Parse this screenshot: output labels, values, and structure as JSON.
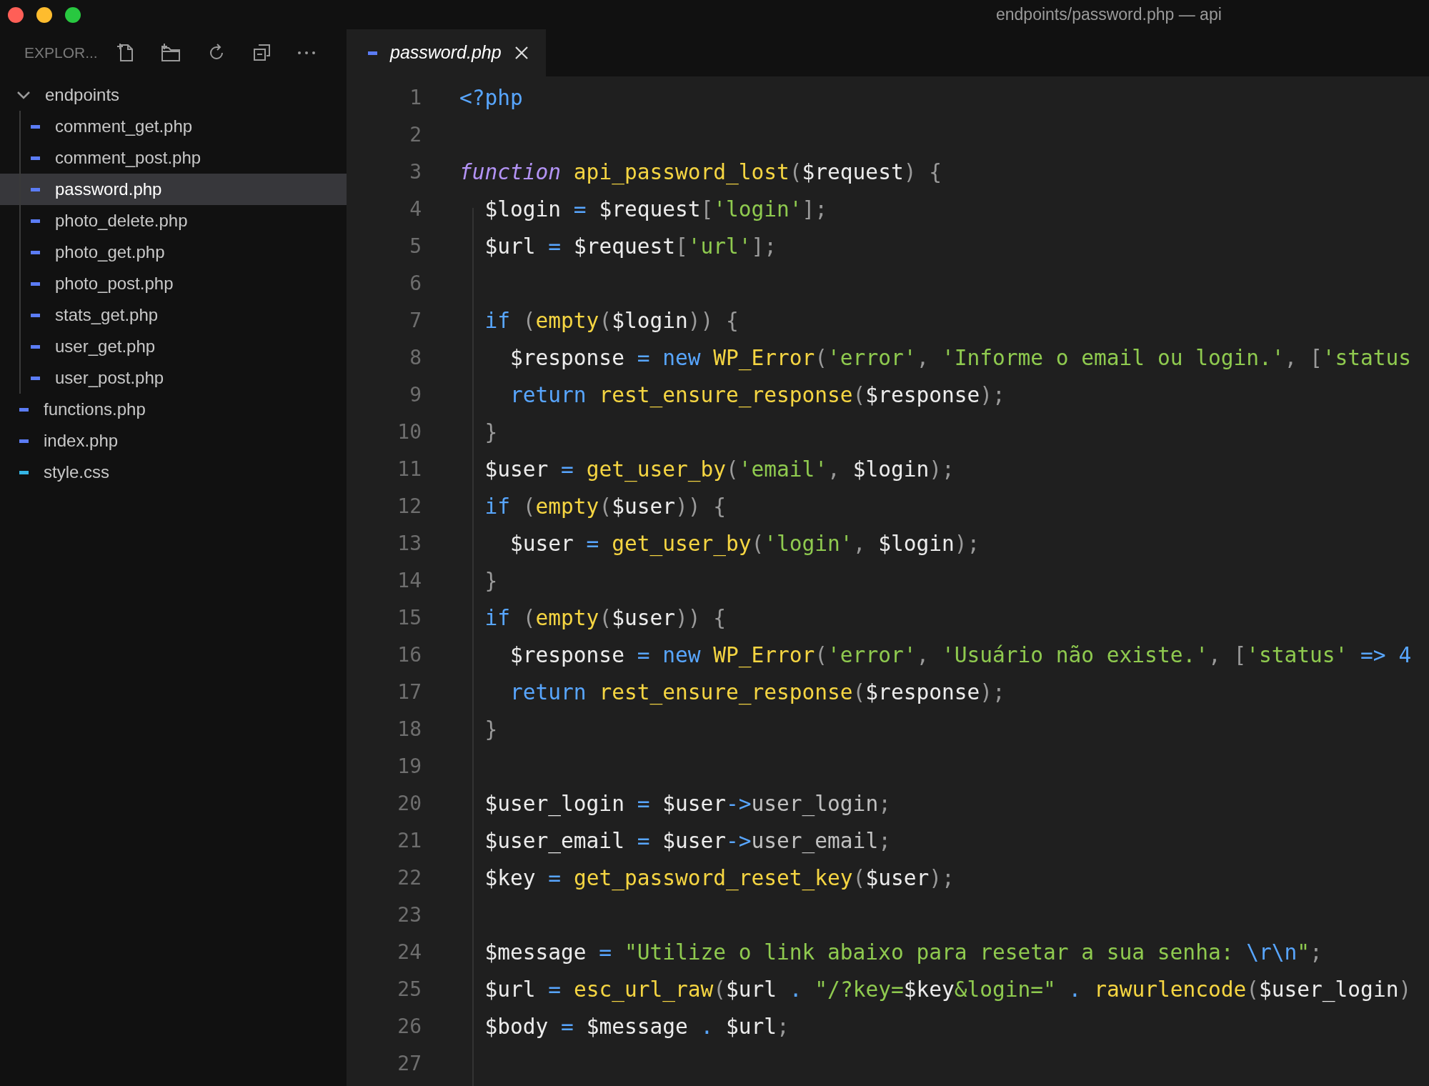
{
  "window": {
    "title": "endpoints/password.php — api"
  },
  "explorer": {
    "title": "EXPLOR...",
    "tree": [
      {
        "label": "endpoints",
        "kind": "folder",
        "expanded": true,
        "selected": false,
        "children": [
          {
            "label": "comment_get.php",
            "kind": "file",
            "selected": false,
            "color": "#5b7cf5"
          },
          {
            "label": "comment_post.php",
            "kind": "file",
            "selected": false,
            "color": "#5b7cf5"
          },
          {
            "label": "password.php",
            "kind": "file",
            "selected": true,
            "color": "#5b7cf5"
          },
          {
            "label": "photo_delete.php",
            "kind": "file",
            "selected": false,
            "color": "#5b7cf5"
          },
          {
            "label": "photo_get.php",
            "kind": "file",
            "selected": false,
            "color": "#5b7cf5"
          },
          {
            "label": "photo_post.php",
            "kind": "file",
            "selected": false,
            "color": "#5b7cf5"
          },
          {
            "label": "stats_get.php",
            "kind": "file",
            "selected": false,
            "color": "#5b7cf5"
          },
          {
            "label": "user_get.php",
            "kind": "file",
            "selected": false,
            "color": "#5b7cf5"
          },
          {
            "label": "user_post.php",
            "kind": "file",
            "selected": false,
            "color": "#5b7cf5"
          }
        ]
      },
      {
        "label": "functions.php",
        "kind": "file",
        "selected": false,
        "color": "#5b7cf5"
      },
      {
        "label": "index.php",
        "kind": "file",
        "selected": false,
        "color": "#5b7cf5"
      },
      {
        "label": "style.css",
        "kind": "file",
        "selected": false,
        "color": "#35b6e6"
      }
    ]
  },
  "tabs": [
    {
      "label": "password.php",
      "selected": true,
      "preview": true,
      "color": "#5b7cf5"
    }
  ],
  "editor": {
    "lines": [
      {
        "number": "1",
        "tokens": [
          {
            "text": "<?php",
            "kind": "k"
          }
        ]
      },
      {
        "number": "2"
      },
      {
        "number": "3",
        "tokens": [
          {
            "text": "function ",
            "kind": "s"
          },
          {
            "text": "api_password_lost",
            "kind": "f"
          },
          {
            "text": "(",
            "kind": "p"
          },
          {
            "text": "$request",
            "kind": "t"
          },
          {
            "text": ") {",
            "kind": "p"
          }
        ]
      },
      {
        "number": "4",
        "tokens": [
          {
            "text": "  $login",
            "kind": "t"
          },
          {
            "text": " = ",
            "kind": "o"
          },
          {
            "text": "$request",
            "kind": "t"
          },
          {
            "text": "[",
            "kind": "p"
          },
          {
            "text": "'login'",
            "kind": "g"
          },
          {
            "text": "];",
            "kind": "p"
          }
        ]
      },
      {
        "number": "5",
        "tokens": [
          {
            "text": "  $url",
            "kind": "t"
          },
          {
            "text": " = ",
            "kind": "o"
          },
          {
            "text": "$request",
            "kind": "t"
          },
          {
            "text": "[",
            "kind": "p"
          },
          {
            "text": "'url'",
            "kind": "g"
          },
          {
            "text": "];",
            "kind": "p"
          }
        ]
      },
      {
        "number": "6"
      },
      {
        "number": "7",
        "tokens": [
          {
            "text": "  if",
            "kind": "k"
          },
          {
            "text": " (",
            "kind": "p"
          },
          {
            "text": "empty",
            "kind": "f"
          },
          {
            "text": "(",
            "kind": "p"
          },
          {
            "text": "$login",
            "kind": "t"
          },
          {
            "text": ")) {",
            "kind": "p"
          }
        ]
      },
      {
        "number": "8",
        "tokens": [
          {
            "text": "    $response",
            "kind": "t"
          },
          {
            "text": " = ",
            "kind": "o"
          },
          {
            "text": "new ",
            "kind": "k"
          },
          {
            "text": "WP_Error",
            "kind": "f"
          },
          {
            "text": "(",
            "kind": "p"
          },
          {
            "text": "'error'",
            "kind": "g"
          },
          {
            "text": ", ",
            "kind": "p"
          },
          {
            "text": "'Informe o email ou login.'",
            "kind": "g"
          },
          {
            "text": ", [",
            "kind": "p"
          },
          {
            "text": "'status",
            "kind": "g"
          }
        ]
      },
      {
        "number": "9",
        "tokens": [
          {
            "text": "    return ",
            "kind": "k"
          },
          {
            "text": "rest_ensure_response",
            "kind": "f"
          },
          {
            "text": "(",
            "kind": "p"
          },
          {
            "text": "$response",
            "kind": "t"
          },
          {
            "text": ");",
            "kind": "p"
          }
        ]
      },
      {
        "number": "10",
        "tokens": [
          {
            "text": "  }",
            "kind": "p"
          }
        ]
      },
      {
        "number": "11",
        "tokens": [
          {
            "text": "  $user",
            "kind": "t"
          },
          {
            "text": " = ",
            "kind": "o"
          },
          {
            "text": "get_user_by",
            "kind": "f"
          },
          {
            "text": "(",
            "kind": "p"
          },
          {
            "text": "'email'",
            "kind": "g"
          },
          {
            "text": ", ",
            "kind": "p"
          },
          {
            "text": "$login",
            "kind": "t"
          },
          {
            "text": ");",
            "kind": "p"
          }
        ]
      },
      {
        "number": "12",
        "tokens": [
          {
            "text": "  if",
            "kind": "k"
          },
          {
            "text": " (",
            "kind": "p"
          },
          {
            "text": "empty",
            "kind": "f"
          },
          {
            "text": "(",
            "kind": "p"
          },
          {
            "text": "$user",
            "kind": "t"
          },
          {
            "text": ")) {",
            "kind": "p"
          }
        ]
      },
      {
        "number": "13",
        "tokens": [
          {
            "text": "    $user",
            "kind": "t"
          },
          {
            "text": " = ",
            "kind": "o"
          },
          {
            "text": "get_user_by",
            "kind": "f"
          },
          {
            "text": "(",
            "kind": "p"
          },
          {
            "text": "'login'",
            "kind": "g"
          },
          {
            "text": ", ",
            "kind": "p"
          },
          {
            "text": "$login",
            "kind": "t"
          },
          {
            "text": ");",
            "kind": "p"
          }
        ]
      },
      {
        "number": "14",
        "tokens": [
          {
            "text": "  }",
            "kind": "p"
          }
        ]
      },
      {
        "number": "15",
        "tokens": [
          {
            "text": "  if",
            "kind": "k"
          },
          {
            "text": " (",
            "kind": "p"
          },
          {
            "text": "empty",
            "kind": "f"
          },
          {
            "text": "(",
            "kind": "p"
          },
          {
            "text": "$user",
            "kind": "t"
          },
          {
            "text": ")) {",
            "kind": "p"
          }
        ]
      },
      {
        "number": "16",
        "tokens": [
          {
            "text": "    $response",
            "kind": "t"
          },
          {
            "text": " = ",
            "kind": "o"
          },
          {
            "text": "new ",
            "kind": "k"
          },
          {
            "text": "WP_Error",
            "kind": "f"
          },
          {
            "text": "(",
            "kind": "p"
          },
          {
            "text": "'error'",
            "kind": "g"
          },
          {
            "text": ", ",
            "kind": "p"
          },
          {
            "text": "'Usuário não existe.'",
            "kind": "g"
          },
          {
            "text": ", [",
            "kind": "p"
          },
          {
            "text": "'status'",
            "kind": "g"
          },
          {
            "text": " => ",
            "kind": "o"
          },
          {
            "text": "4",
            "kind": "k"
          }
        ]
      },
      {
        "number": "17",
        "tokens": [
          {
            "text": "    return ",
            "kind": "k"
          },
          {
            "text": "rest_ensure_response",
            "kind": "f"
          },
          {
            "text": "(",
            "kind": "p"
          },
          {
            "text": "$response",
            "kind": "t"
          },
          {
            "text": ");",
            "kind": "p"
          }
        ]
      },
      {
        "number": "18",
        "tokens": [
          {
            "text": "  }",
            "kind": "p"
          }
        ]
      },
      {
        "number": "19"
      },
      {
        "number": "20",
        "tokens": [
          {
            "text": "  $user_login",
            "kind": "t"
          },
          {
            "text": " = ",
            "kind": "o"
          },
          {
            "text": "$user",
            "kind": "t"
          },
          {
            "text": "->",
            "kind": "o"
          },
          {
            "text": "user_login",
            "kind": "r"
          },
          {
            "text": ";",
            "kind": "p"
          }
        ]
      },
      {
        "number": "21",
        "tokens": [
          {
            "text": "  $user_email",
            "kind": "t"
          },
          {
            "text": " = ",
            "kind": "o"
          },
          {
            "text": "$user",
            "kind": "t"
          },
          {
            "text": "->",
            "kind": "o"
          },
          {
            "text": "user_email",
            "kind": "r"
          },
          {
            "text": ";",
            "kind": "p"
          }
        ]
      },
      {
        "number": "22",
        "tokens": [
          {
            "text": "  $key",
            "kind": "t"
          },
          {
            "text": " = ",
            "kind": "o"
          },
          {
            "text": "get_password_reset_key",
            "kind": "f"
          },
          {
            "text": "(",
            "kind": "p"
          },
          {
            "text": "$user",
            "kind": "t"
          },
          {
            "text": ");",
            "kind": "p"
          }
        ]
      },
      {
        "number": "23"
      },
      {
        "number": "24",
        "tokens": [
          {
            "text": "  $message",
            "kind": "t"
          },
          {
            "text": " = ",
            "kind": "o"
          },
          {
            "text": "\"Utilize o link abaixo para resetar a sua senha: ",
            "kind": "g"
          },
          {
            "text": "\\r\\n",
            "kind": "o"
          },
          {
            "text": "\"",
            "kind": "g"
          },
          {
            "text": ";",
            "kind": "p"
          }
        ]
      },
      {
        "number": "25",
        "tokens": [
          {
            "text": "  $url",
            "kind": "t"
          },
          {
            "text": " = ",
            "kind": "o"
          },
          {
            "text": "esc_url_raw",
            "kind": "f"
          },
          {
            "text": "(",
            "kind": "p"
          },
          {
            "text": "$url",
            "kind": "t"
          },
          {
            "text": " . ",
            "kind": "o"
          },
          {
            "text": "\"/?key=",
            "kind": "g"
          },
          {
            "text": "$key",
            "kind": "t"
          },
          {
            "text": "&login=\"",
            "kind": "g"
          },
          {
            "text": " . ",
            "kind": "o"
          },
          {
            "text": "rawurlencode",
            "kind": "f"
          },
          {
            "text": "(",
            "kind": "p"
          },
          {
            "text": "$user_login",
            "kind": "t"
          },
          {
            "text": ")",
            "kind": "p"
          }
        ]
      },
      {
        "number": "26",
        "tokens": [
          {
            "text": "  $body",
            "kind": "t"
          },
          {
            "text": " = ",
            "kind": "o"
          },
          {
            "text": "$message",
            "kind": "t"
          },
          {
            "text": " . ",
            "kind": "o"
          },
          {
            "text": "$url",
            "kind": "t"
          },
          {
            "text": ";",
            "kind": "p"
          }
        ]
      },
      {
        "number": "27"
      }
    ]
  }
}
